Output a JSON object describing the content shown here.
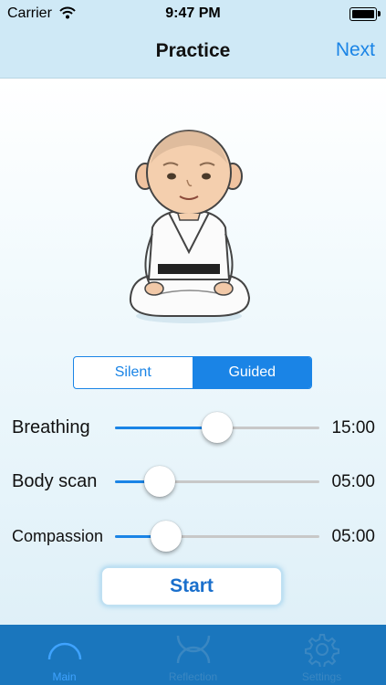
{
  "status": {
    "carrier": "Carrier",
    "time": "9:47 PM"
  },
  "nav": {
    "title": "Practice",
    "next_label": "Next"
  },
  "mode": {
    "options": [
      "Silent",
      "Guided"
    ],
    "selected": "Guided"
  },
  "sliders": [
    {
      "label": "Breathing",
      "value": "15:00",
      "level": 0.5
    },
    {
      "label": "Body scan",
      "value": "05:00",
      "level": 0.22
    },
    {
      "label": "Compassion",
      "value": "05:00",
      "level": 0.25
    }
  ],
  "start_label": "Start",
  "tabs": [
    {
      "label": "Main",
      "icon": "arc-icon",
      "selected": true
    },
    {
      "label": "Reflection",
      "icon": "reflection-icon",
      "selected": false
    },
    {
      "label": "Settings",
      "icon": "gear-icon",
      "selected": false
    }
  ],
  "colors": {
    "accent": "#1a84e6",
    "tab_bar": "#1a76bd",
    "nav_bar": "#cfe9f6"
  }
}
